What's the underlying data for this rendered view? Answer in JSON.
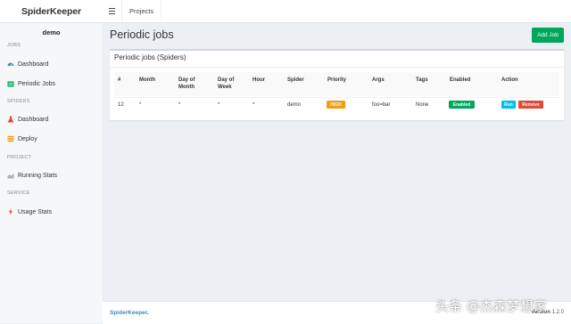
{
  "header": {
    "logo": "SpiderKeeper",
    "nav_projects": "Projects"
  },
  "sidebar": {
    "user": "demo",
    "sections": {
      "jobs": "JOBS",
      "spiders": "SPIDERS",
      "project": "PROJECT",
      "service": "SERVICE"
    },
    "items": [
      {
        "label": "Dashboard",
        "icon": "dashboard-icon",
        "color": "#3c8dbc"
      },
      {
        "label": "Periodic Jobs",
        "icon": "calendar-icon",
        "color": "#00a65a"
      },
      {
        "label": "Dashboard",
        "icon": "flask-icon",
        "color": "#dd4b39"
      },
      {
        "label": "Deploy",
        "icon": "list-icon",
        "color": "#f39c12"
      },
      {
        "label": "Running Stats",
        "icon": "area-chart-icon",
        "color": "#b0b4b8"
      },
      {
        "label": "Usage Stats",
        "icon": "bolt-icon",
        "color": "#dd4b39"
      }
    ]
  },
  "main": {
    "title": "Periodic jobs",
    "add_job": "Add Job",
    "box_title": "Periodic jobs (Spiders)",
    "columns": [
      "#",
      "Month",
      "Day of Month",
      "Day of Week",
      "Hour",
      "Spider",
      "Priority",
      "Args",
      "Tags",
      "Enabled",
      "Action"
    ],
    "columns_lines": {
      "day_of_month": [
        "Day of",
        "Month"
      ],
      "day_of_week": [
        "Day of",
        "Week"
      ]
    },
    "rows": [
      {
        "id": "12",
        "month": "*",
        "day_of_month": "*",
        "day_of_week": "*",
        "hour": "*",
        "spider": "demo",
        "priority": "HIGH",
        "args": "foo=bar",
        "tags": "None",
        "enabled": "Enabled",
        "run": "Run",
        "remove": "Remove"
      }
    ]
  },
  "footer": {
    "brand": "SpiderKeeper",
    "brand_dot": ".",
    "version_label": "Version",
    "version": "1.2.0"
  },
  "watermark": "头条 @杰森梦想家",
  "colors": {
    "add_job": "#00a65a",
    "priority_high": "#f39c12",
    "enabled": "#00a65a",
    "run": "#00c0ef",
    "remove": "#dd4b39",
    "brand": "#3c8dbc"
  }
}
